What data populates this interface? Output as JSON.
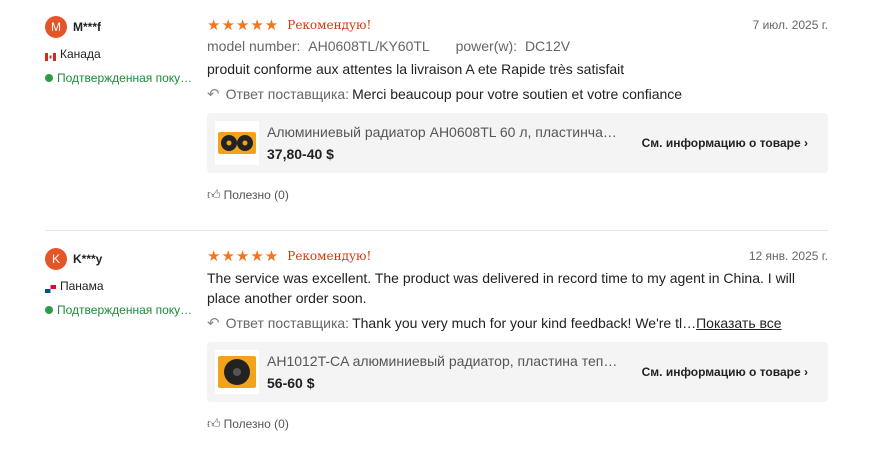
{
  "reviews": [
    {
      "avatar_letter": "M",
      "username": "M***f",
      "country": "Канада",
      "verified": "Подтвержденная поку…",
      "stars": "★★★★★",
      "recommend": "Рекомендую!",
      "date": "7 июл. 2025 г.",
      "attr1_label": "model number:",
      "attr1_value": "AH0608TL/KY60TL",
      "attr2_label": "power(w):",
      "attr2_value": "DC12V",
      "text": "produit conforme aux attentes la livraison A ete Rapide très satisfait",
      "reply_label": "Ответ поставщика:",
      "reply_text": "Merci beaucoup pour votre soutien et votre confiance",
      "product_name": "Алюминиевый радиатор AH0608TL 60 л, пластинча…",
      "product_price": "37,80-40 $",
      "product_more": "См. информацию о товаре",
      "helpful": "Полезно (0)"
    },
    {
      "avatar_letter": "K",
      "username": "K***y",
      "country": "Панама",
      "verified": "Подтвержденная поку…",
      "stars": "★★★★★",
      "recommend": "Рекомендую!",
      "date": "12 янв. 2025 г.",
      "text": "The service was excellent. The product was delivered in record time to my agent in China. I will place another order soon.",
      "reply_label": "Ответ поставщика:",
      "reply_text": "Thank you very much for your kind feedback! We're tl…",
      "show_all": "Показать все",
      "product_name": "AH1012T-CA алюминиевый радиатор, пластина теп…",
      "product_price": "56-60 $",
      "product_more": "См. информацию о товаре",
      "helpful": "Полезно (0)"
    }
  ],
  "colors": {
    "star": "#f5751c",
    "avatar": "#e4562a",
    "verified": "#1e8a3a"
  }
}
